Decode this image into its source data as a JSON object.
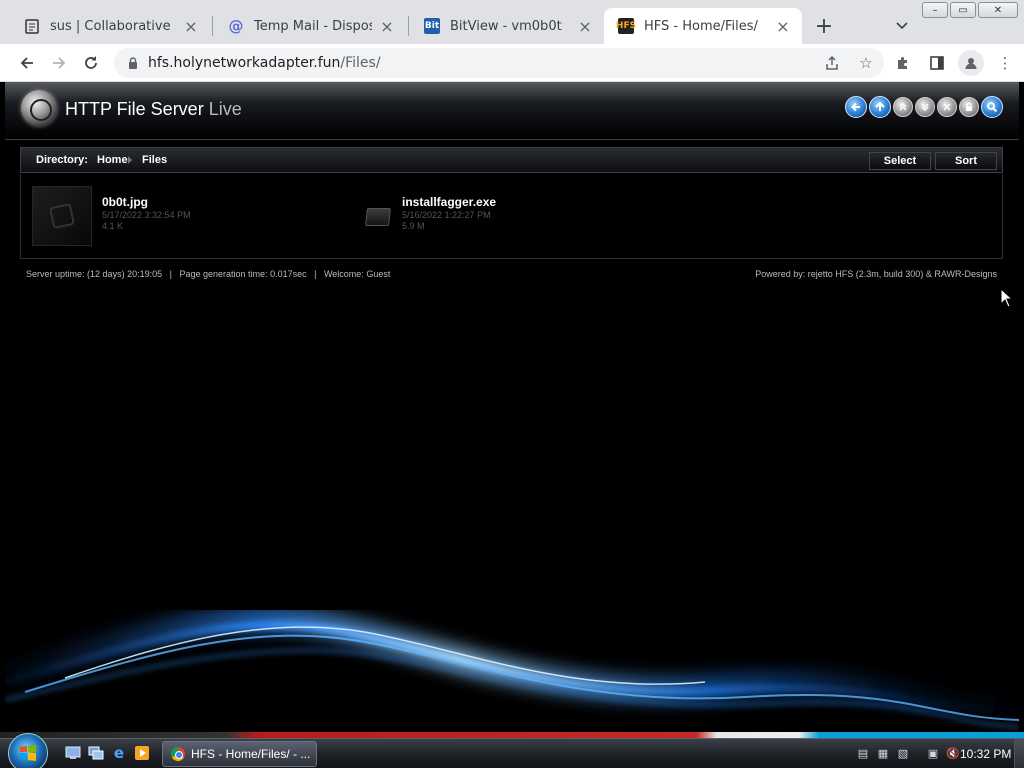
{
  "browser": {
    "tabs": [
      {
        "title": "sus | Collaborative Notep",
        "active": false
      },
      {
        "title": "Temp Mail - Disposable T",
        "active": false
      },
      {
        "title": "BitView - vm0b0t",
        "active": false
      },
      {
        "title": "HFS - Home/Files/",
        "active": true
      }
    ],
    "url_host": "hfs.holynetworkadapter.fun",
    "url_path": "/Files/",
    "accent_color": "#1a73e8"
  },
  "hfs": {
    "title": "HTTP File Server",
    "title_suffix": "Live",
    "header_icons": [
      "back-icon",
      "up-icon",
      "collapse-icon",
      "expand-icon",
      "close-icon",
      "lock-icon",
      "search-icon"
    ],
    "directory_label": "Directory:",
    "breadcrumb": [
      "Home",
      "Files"
    ],
    "select_label": "Select",
    "sort_label": "Sort",
    "files": [
      {
        "name": "0b0t.jpg",
        "date": "5/17/2022 3:32:54 PM",
        "size": "4.1 K",
        "type": "image"
      },
      {
        "name": "installfagger.exe",
        "date": "5/16/2022 1:22:27 PM",
        "size": "5.9 M",
        "type": "executable"
      }
    ],
    "status": {
      "uptime_label": "Server uptime:",
      "uptime": "(12 days) 20:19:05",
      "gen_label": "Page generation time:",
      "gen_time": "0.017sec",
      "welcome_label": "Welcome:",
      "welcome_user": "Guest",
      "powered_by": "Powered by: rejetto HFS (2.3m, build 300) & RAWR-Designs"
    }
  },
  "taskbar": {
    "task_title": "HFS - Home/Files/ - ...",
    "clock": "10:32 PM"
  }
}
